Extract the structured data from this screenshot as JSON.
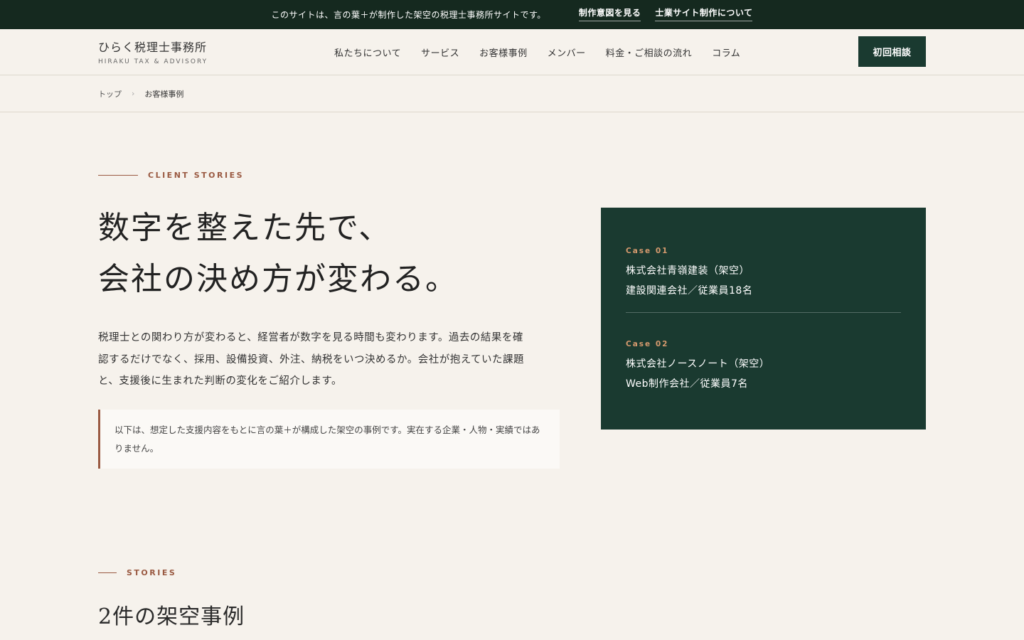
{
  "notice": {
    "message": "このサイトは、言の葉＋が制作した架空の税理士事務所サイトです。",
    "link_intent": "制作意図を見る",
    "link_about": "士業サイト制作について"
  },
  "header": {
    "logo_jp": "ひらく税理士事務所",
    "logo_en": "HIRAKU TAX & ADVISORY",
    "nav": [
      "私たちについて",
      "サービス",
      "お客様事例",
      "メンバー",
      "料金・ご相談の流れ",
      "コラム"
    ],
    "cta": "初回相談"
  },
  "breadcrumb": {
    "home": "トップ",
    "separator": "›",
    "current": "お客様事例"
  },
  "hero": {
    "eyebrow": "CLIENT STORIES",
    "title_line1": "数字を整えた先で、",
    "title_line2": "会社の決め方が変わる。",
    "text": "税理士との関わり方が変わると、経営者が数字を見る時間も変わります。過去の結果を確認するだけでなく、採用、設備投資、外注、納税をいつ決めるか。会社が抱えていた課題と、支援後に生まれた判断の変化をご紹介します。",
    "disclaimer": "以下は、想定した支援内容をもとに言の葉＋が構成した架空の事例です。実在する企業・人物・実績ではありません。"
  },
  "cases": [
    {
      "label": "Case 01",
      "name": "株式会社青嶺建装（架空）",
      "meta": "建設関連会社／従業員18名"
    },
    {
      "label": "Case 02",
      "name": "株式会社ノースノート（架空）",
      "meta": "Web制作会社／従業員7名"
    }
  ],
  "stories": {
    "eyebrow": "STORIES",
    "title": "2件の架空事例"
  },
  "colors": {
    "dark_green": "#1a3a30",
    "notice_bg": "#15291f",
    "accent": "#9a5a42",
    "case_label": "#d69a6e",
    "background": "#f6f2ec"
  }
}
